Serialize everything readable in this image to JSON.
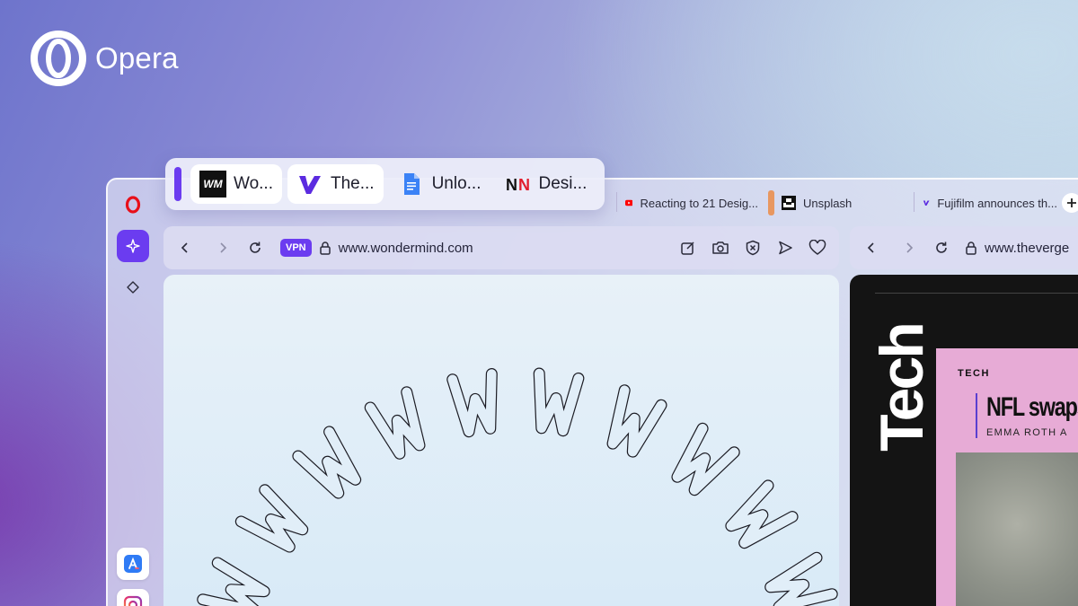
{
  "brand": {
    "name": "Opera"
  },
  "tab_island": {
    "tabs": [
      {
        "label": "Wo...",
        "icon": "wondermind-icon",
        "active": true
      },
      {
        "label": "The...",
        "icon": "verge-icon",
        "active": true
      },
      {
        "label": "Unlo...",
        "icon": "google-docs-icon",
        "active": false
      },
      {
        "label": "Desi...",
        "icon": "nn-group-icon",
        "active": false
      }
    ]
  },
  "tab_strip": {
    "tabs": [
      {
        "label": "Reacting to 21 Desig...",
        "icon": "youtube-icon"
      },
      {
        "label": "Unsplash",
        "icon": "unsplash-icon"
      },
      {
        "label": "Fujifilm announces th...",
        "icon": "verge-icon"
      }
    ],
    "new_tab_icon": "plus-icon"
  },
  "left_pane": {
    "vpn_label": "VPN",
    "url": "www.wondermind.com",
    "toolbar_icons": [
      "snapshot-edit-icon",
      "camera-icon",
      "shield-x-icon",
      "send-icon",
      "heart-icon"
    ]
  },
  "right_pane": {
    "url": "www.theverge",
    "section_vertical": "Tech",
    "section_label": "TECH",
    "headline": "NFL swaps f",
    "byline": "EMMA ROTH   A"
  },
  "sidebar": {
    "items": [
      "opera-icon",
      "aria-sparkle-icon",
      "diamond-icon"
    ],
    "apps": [
      "app-store-icon",
      "instagram-icon"
    ]
  },
  "colors": {
    "accent": "#6b3cf0",
    "opera_red": "#e8101a",
    "pink_card": "#e7abd6",
    "verge_dark": "#141414"
  }
}
